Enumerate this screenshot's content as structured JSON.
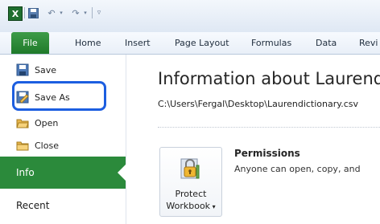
{
  "quick_access": {
    "app_icon": "excel-icon",
    "save_icon": "save-icon",
    "undo_icon": "undo-icon",
    "redo_icon": "redo-icon",
    "customize_icon": "customize-qat-icon"
  },
  "ribbon": {
    "tabs": [
      {
        "label": "File"
      },
      {
        "label": "Home"
      },
      {
        "label": "Insert"
      },
      {
        "label": "Page Layout"
      },
      {
        "label": "Formulas"
      },
      {
        "label": "Data"
      },
      {
        "label": "Revi"
      }
    ]
  },
  "backstage": {
    "items": [
      {
        "label": "Save",
        "icon": "save-icon"
      },
      {
        "label": "Save As",
        "icon": "save-as-icon"
      },
      {
        "label": "Open",
        "icon": "open-folder-icon"
      },
      {
        "label": "Close",
        "icon": "close-folder-icon"
      }
    ],
    "sections": [
      {
        "label": "Info"
      },
      {
        "label": "Recent"
      }
    ]
  },
  "info": {
    "title": "Information about Laurendic",
    "path": "C:\\Users\\Fergal\\Desktop\\Laurendictionary.csv",
    "protect_button": {
      "line1": "Protect",
      "line2": "Workbook"
    },
    "permissions_title": "Permissions",
    "permissions_desc": "Anyone can open, copy, and"
  },
  "colors": {
    "file_tab": "#2b8a3b",
    "highlight": "#1c5ee0"
  }
}
